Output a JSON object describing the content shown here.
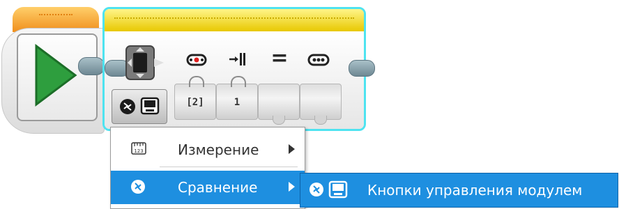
{
  "colors": {
    "start_block_top": "#f08f1c",
    "compare_block_top": "#f2d600",
    "selection_outline": "#4ee3f0",
    "menu_highlight": "#1e8fe0",
    "play_green": "#2e9e3e"
  },
  "start_block": {
    "icon": "play-icon"
  },
  "compare_block": {
    "icons": [
      "dpad-icon",
      "port-icon",
      "port-input-icon",
      "equals-icon",
      "brick-buttons-icon"
    ],
    "equals_symbol": "=",
    "params": [
      "[2]",
      "1",
      "",
      ""
    ],
    "mode_icons": [
      "compare-icon",
      "brick-icon"
    ]
  },
  "menu": {
    "items": [
      {
        "label": "Измерение",
        "icon": "ruler-icon",
        "has_submenu": true,
        "selected": false
      },
      {
        "label": "Сравнение",
        "icon": "compare-icon",
        "has_submenu": true,
        "selected": true
      }
    ]
  },
  "submenu": {
    "label": "Кнопки управления модулем",
    "icons": [
      "compare-icon",
      "brick-icon"
    ]
  }
}
